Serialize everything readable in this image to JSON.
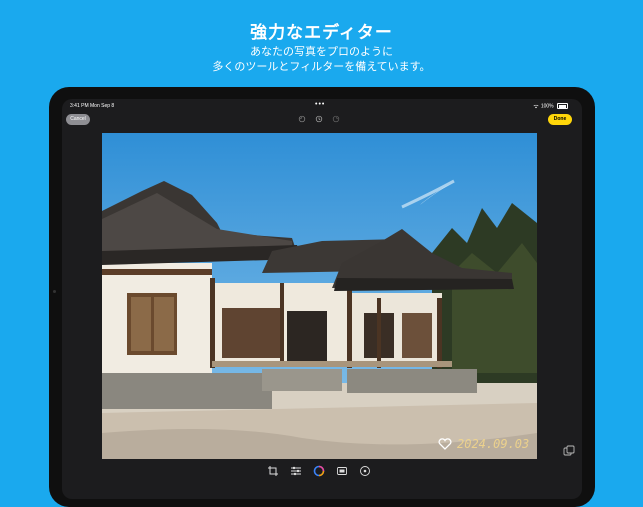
{
  "promo": {
    "title": "強力なエディター",
    "subtitle_line1": "あなたの写真をプロのように",
    "subtitle_line2": "多くのツールとフィルターを備えています。"
  },
  "status_bar": {
    "time": "3:41 PM",
    "date": "Mon Sep 8",
    "battery": "100%"
  },
  "toolbar": {
    "cancel_label": "Cancel",
    "done_label": "Done"
  },
  "photo": {
    "watermark": "2024.09.03"
  },
  "bottom_tools": [
    "crop-icon",
    "adjust-icon",
    "filter-icon",
    "frame-icon",
    "watermark-icon"
  ],
  "colors": {
    "background": "#1aa9ee",
    "done": "#ffd60a",
    "cancel": "#8e8e93",
    "filter_accent": "#3b82f6"
  }
}
